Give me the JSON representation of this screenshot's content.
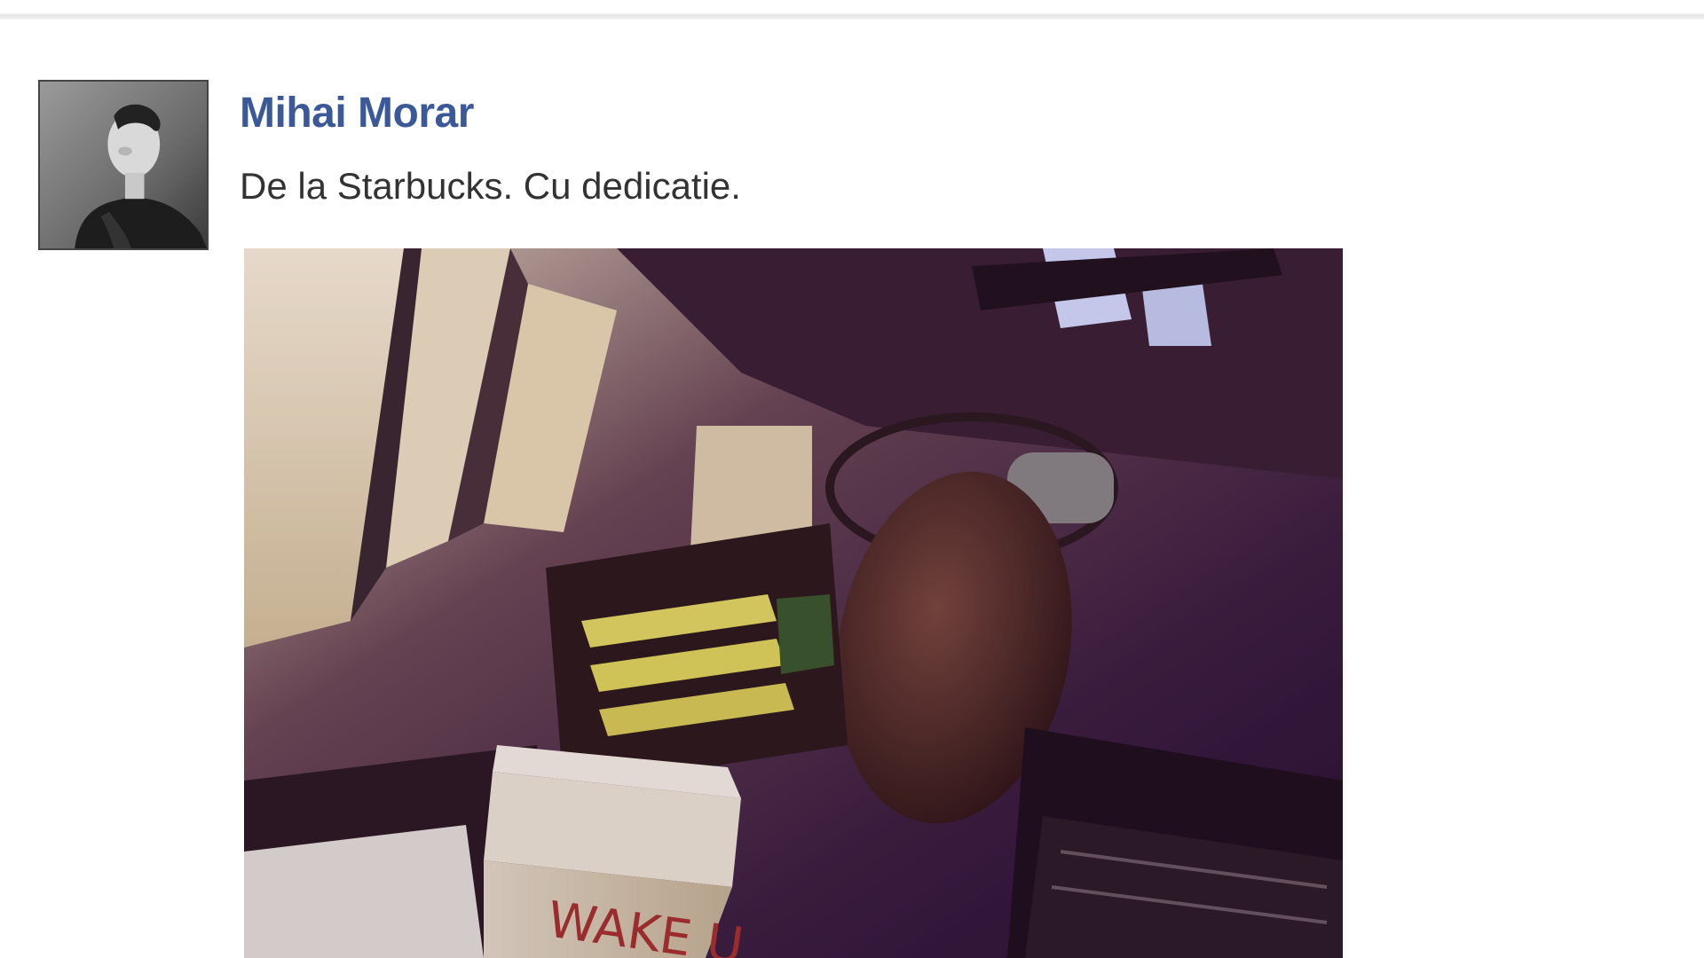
{
  "post": {
    "author_name": "Mihai Morar",
    "message": "De la Starbucks. Cu dedicatie.",
    "avatar_icon": "profile-photo",
    "photo_icon": "studio-microphone-coffee-photo",
    "photo_cup_text": "WAKE U"
  },
  "colors": {
    "author_link": "#3b5998",
    "message_text": "#333333",
    "divider": "#e6e6e6"
  }
}
